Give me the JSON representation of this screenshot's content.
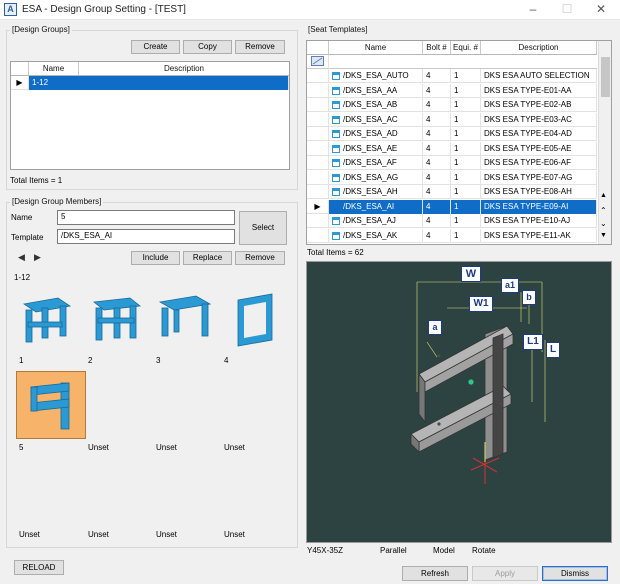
{
  "window": {
    "app_icon_letter": "A",
    "title": "ESA - Design Group Setting - [TEST]",
    "minimize": "–",
    "maximize": "☐",
    "close": "✕"
  },
  "design_groups": {
    "label": "[Design Groups]",
    "buttons": {
      "create": "Create",
      "copy": "Copy",
      "remove": "Remove"
    },
    "columns": {
      "name": "Name",
      "description": "Description"
    },
    "rows": [
      {
        "name": "1-12",
        "description": ""
      }
    ],
    "total": "Total Items = 1"
  },
  "members": {
    "label": "[Design Group Members]",
    "name_label": "Name",
    "name_value": "5",
    "template_label": "Template",
    "template_value": "/DKS_ESA_AI",
    "select": "Select",
    "nav_prev": "◀",
    "nav_next": "▶",
    "include": "Include",
    "replace": "Replace",
    "remove": "Remove",
    "group_title": "1-12",
    "slots": [
      "1",
      "2",
      "3",
      "4",
      "5",
      "Unset",
      "Unset",
      "Unset",
      "Unset",
      "Unset",
      "Unset",
      "Unset"
    ]
  },
  "seat_templates": {
    "label": "[Seat Templates]",
    "columns": {
      "name": "Name",
      "bolt": "Bolt #",
      "equi": "Equi. #",
      "description": "Description"
    },
    "rows": [
      {
        "name": "/DKS_ESA_AUTO",
        "bolt": "4",
        "equi": "1",
        "description": "DKS ESA AUTO SELECTION"
      },
      {
        "name": "/DKS_ESA_AA",
        "bolt": "4",
        "equi": "1",
        "description": "DKS ESA TYPE-E01-AA"
      },
      {
        "name": "/DKS_ESA_AB",
        "bolt": "4",
        "equi": "1",
        "description": "DKS ESA TYPE-E02-AB"
      },
      {
        "name": "/DKS_ESA_AC",
        "bolt": "4",
        "equi": "1",
        "description": "DKS ESA TYPE-E03-AC"
      },
      {
        "name": "/DKS_ESA_AD",
        "bolt": "4",
        "equi": "1",
        "description": "DKS ESA TYPE-E04-AD"
      },
      {
        "name": "/DKS_ESA_AE",
        "bolt": "4",
        "equi": "1",
        "description": "DKS ESA TYPE-E05-AE"
      },
      {
        "name": "/DKS_ESA_AF",
        "bolt": "4",
        "equi": "1",
        "description": "DKS ESA TYPE-E06-AF"
      },
      {
        "name": "/DKS_ESA_AG",
        "bolt": "4",
        "equi": "1",
        "description": "DKS ESA TYPE-E07-AG"
      },
      {
        "name": "/DKS_ESA_AH",
        "bolt": "4",
        "equi": "1",
        "description": "DKS ESA TYPE-E08-AH"
      },
      {
        "name": "/DKS_ESA_AI",
        "bolt": "4",
        "equi": "1",
        "description": "DKS ESA TYPE-E09-AI"
      },
      {
        "name": "/DKS_ESA_AJ",
        "bolt": "4",
        "equi": "1",
        "description": "DKS ESA TYPE-E10-AJ"
      },
      {
        "name": "/DKS_ESA_AK",
        "bolt": "4",
        "equi": "1",
        "description": "DKS ESA TYPE-E11-AK"
      }
    ],
    "selected_index": 9,
    "total": "Total Items = 62"
  },
  "preview": {
    "dims": {
      "W": "W",
      "W1": "W1",
      "a1": "a1",
      "b": "b",
      "a": "a",
      "L1": "L1",
      "L": "L"
    },
    "status": {
      "profile": "Y45X-35Z",
      "projection": "Parallel",
      "mode": "Model",
      "action": "Rotate"
    }
  },
  "footer": {
    "reload": "RELOAD",
    "refresh": "Refresh",
    "apply": "Apply",
    "dismiss": "Dismiss"
  },
  "colors": {
    "accent": "#0f6cc7",
    "thumb_blue": "#2b9ad4",
    "viewport_bg": "#2c4342",
    "selected_thumb_bg": "#f7b36a"
  }
}
